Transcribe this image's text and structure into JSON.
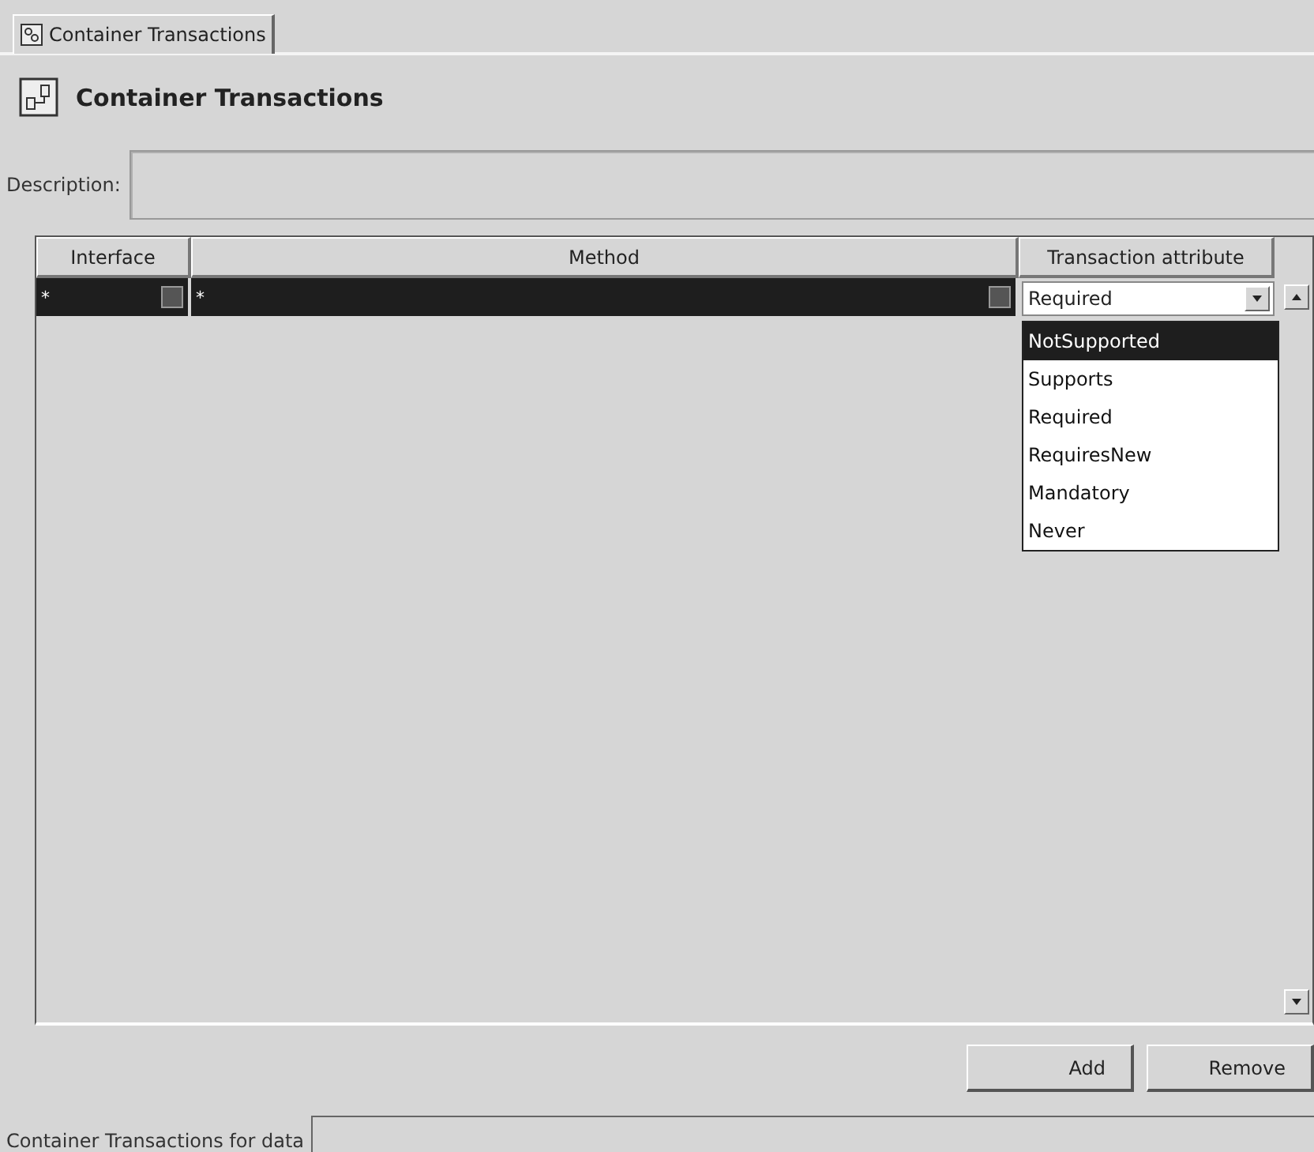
{
  "tabs": [
    {
      "label": "Container Transactions",
      "selected": true
    }
  ],
  "header": {
    "title": "Container Transactions"
  },
  "description": {
    "label": "Description:"
  },
  "table": {
    "columns": [
      "Interface",
      "Method",
      "Transaction attribute"
    ],
    "rows": [
      {
        "interface": "*",
        "method": "*",
        "attribute": "Required",
        "selected": true
      }
    ]
  },
  "dropdown": {
    "expanded": true,
    "options": [
      {
        "label": "NotSupported",
        "selected": true
      },
      {
        "label": "Supports",
        "selected": false
      },
      {
        "label": "Required",
        "selected": false
      },
      {
        "label": "RequiresNew",
        "selected": false
      },
      {
        "label": "Mandatory",
        "selected": false
      },
      {
        "label": "Never",
        "selected": false
      }
    ]
  },
  "buttons": [
    "Add",
    "Remove"
  ],
  "footer": {
    "label": "Container Transactions for data"
  }
}
